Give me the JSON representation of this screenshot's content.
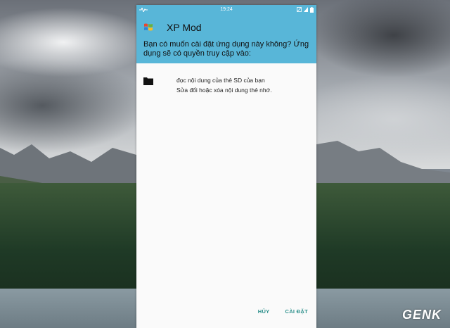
{
  "status_bar": {
    "time": "19:24",
    "left_icon": "activity-icon",
    "right_icons": [
      "mute-icon",
      "signal-icon",
      "battery-icon"
    ]
  },
  "dialog": {
    "app_name": "XP Mod",
    "app_icon": "windows-logo-icon",
    "prompt": "Bạn có muốn cài đặt ứng dụng này không? Ứng dụng sẽ có quyền truy cập vào:",
    "permissions": [
      {
        "icon": "folder-icon",
        "lines": [
          "đọc nội dung của thẻ SD của bạn",
          "Sửa đổi hoặc xóa nội dung thẻ nhớ."
        ]
      }
    ],
    "cancel_label": "HỦY",
    "install_label": "CÀI ĐẶT"
  },
  "watermark": "GENK",
  "colors": {
    "header": "#58b6d8",
    "action_text": "#2a8f8a",
    "dialog_bg": "#fafafa"
  }
}
